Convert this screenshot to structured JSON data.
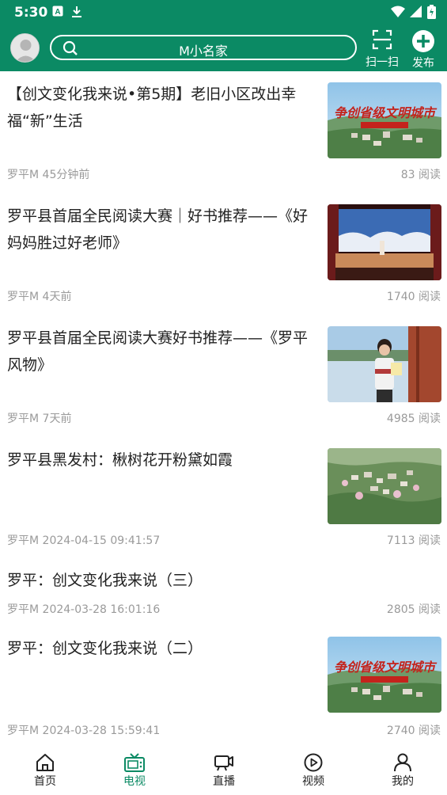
{
  "status": {
    "time": "5:30"
  },
  "header": {
    "search_text": "M小名家",
    "scan_label": "扫一扫",
    "publish_label": "发布"
  },
  "colors": {
    "brand": "#0b8a64",
    "meta": "#9a9a9a"
  },
  "feed": [
    {
      "title": "【创文变化我来说•第5期】老旧小区改出幸福“新”生活",
      "source": "罗平M",
      "time": "45分钟前",
      "reads": "83 阅读",
      "thumb_icon": "aerial-town-banner-image"
    },
    {
      "title": "罗平县首届全民阅读大赛｜好书推荐——《好妈妈胜过好老师》",
      "source": "罗平M",
      "time": "4天前",
      "reads": "1740 阅读",
      "thumb_icon": "stage-performance-image"
    },
    {
      "title": "罗平县首届全民阅读大赛好书推荐——《罗平风物》",
      "source": "罗平M",
      "time": "7天前",
      "reads": "4985 阅读",
      "thumb_icon": "woman-reading-image"
    },
    {
      "title": "罗平县黑发村：楸树花开粉黛如霞",
      "source": "罗平M",
      "time": "2024-04-15 09:41:57",
      "reads": "7113 阅读",
      "thumb_icon": "village-aerial-image"
    },
    {
      "title": "罗平：创文变化我来说（三）",
      "source": "罗平M",
      "time": "2024-03-28 16:01:16",
      "reads": "2805 阅读",
      "thumb_icon": ""
    },
    {
      "title": "罗平：创文变化我来说（二）",
      "source": "罗平M",
      "time": "2024-03-28 15:59:41",
      "reads": "2740 阅读",
      "thumb_icon": "aerial-town-banner-image"
    }
  ],
  "tabs": [
    {
      "label": "首页",
      "icon": "home-icon"
    },
    {
      "label": "电视",
      "icon": "tv-icon",
      "active": true
    },
    {
      "label": "直播",
      "icon": "live-camera-icon"
    },
    {
      "label": "视频",
      "icon": "play-icon"
    },
    {
      "label": "我的",
      "icon": "user-icon"
    }
  ]
}
